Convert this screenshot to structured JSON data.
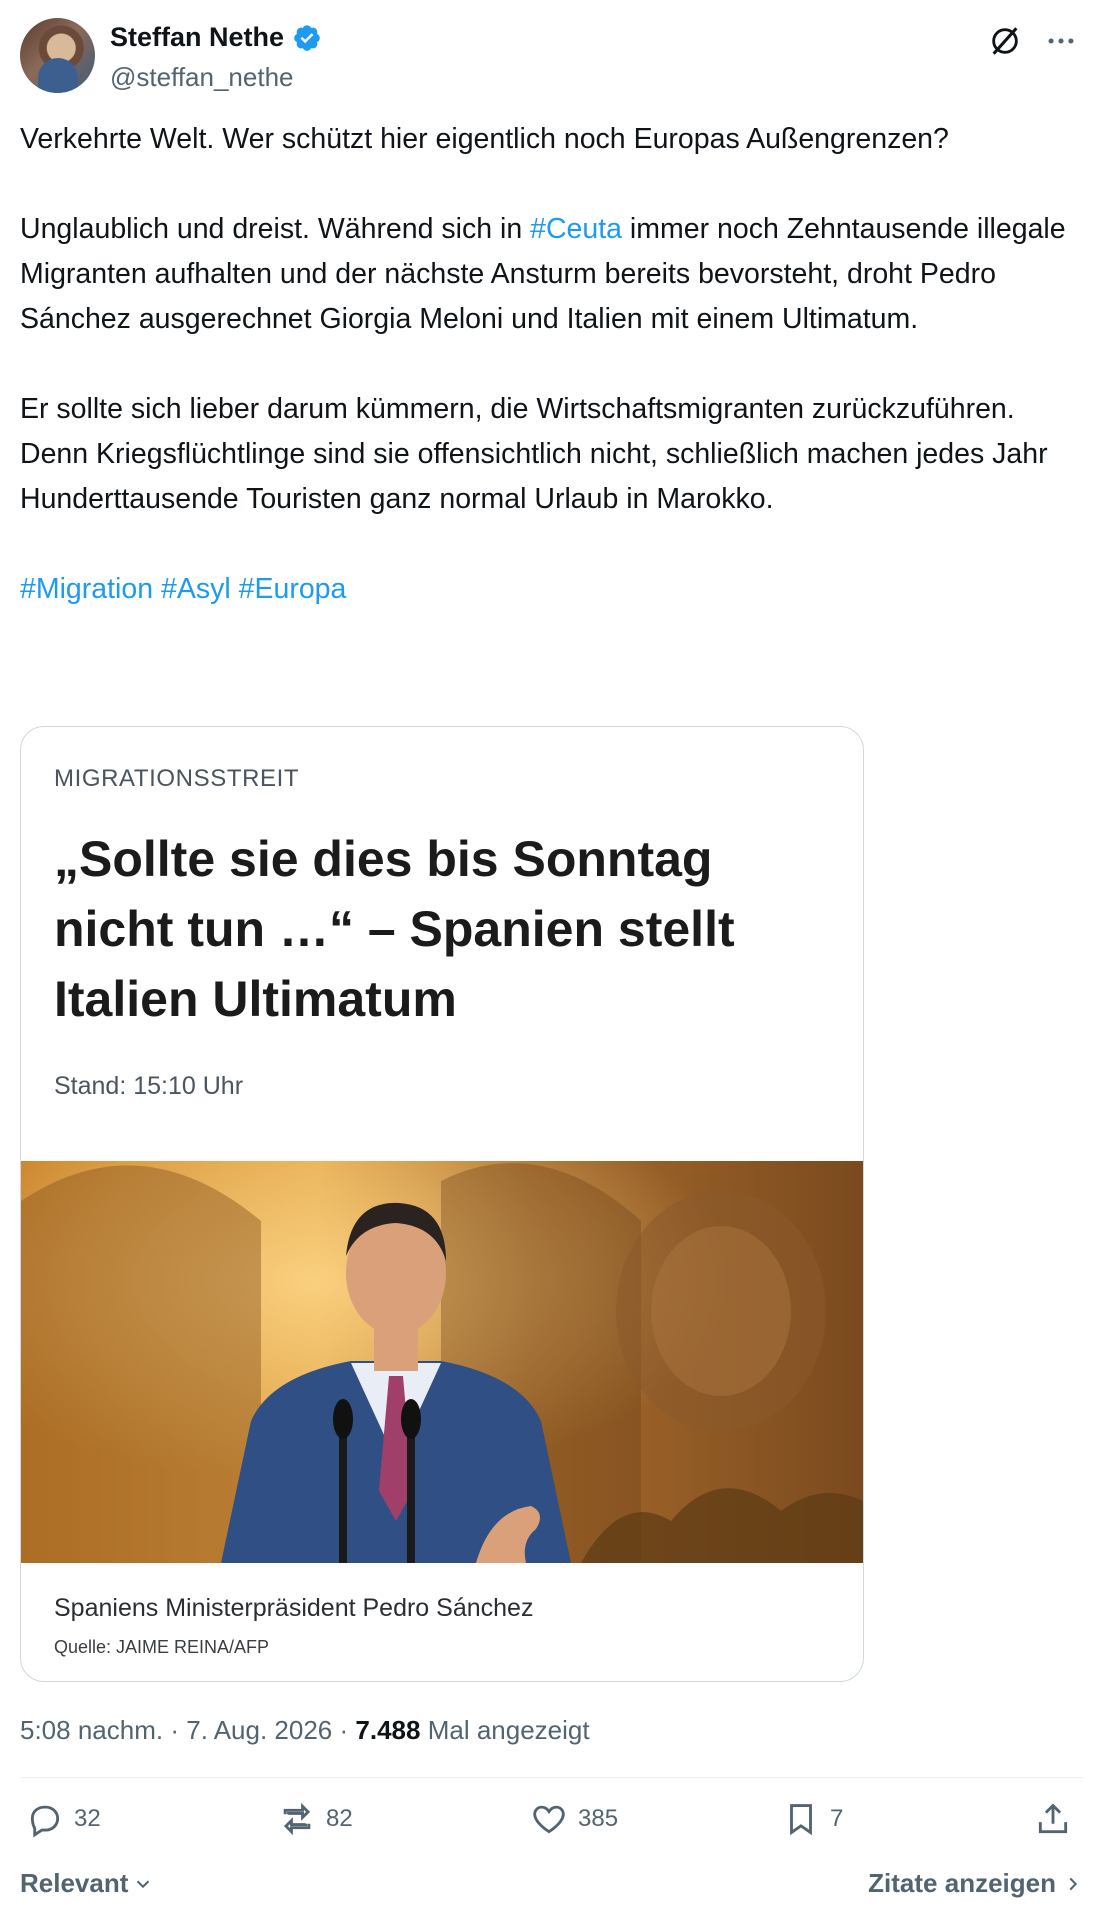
{
  "author": {
    "display_name": "Steffan Nethe",
    "handle": "@steffan_nethe",
    "verified": true
  },
  "tweet": {
    "paragraphs": [
      [
        {
          "t": "Verkehrte Welt. Wer schützt hier eigentlich noch Europas Außengrenzen?"
        }
      ],
      [
        {
          "t": "Unglaublich und dreist. Während sich in "
        },
        {
          "t": "#Ceuta",
          "tag": true
        },
        {
          "t": " immer noch Zehntausende illegale Migranten aufhalten und der nächste Ansturm bereits bevorsteht, droht Pedro Sánchez ausgerechnet Giorgia Meloni und Italien mit einem Ultimatum."
        }
      ],
      [
        {
          "t": "Er sollte sich lieber darum kümmern, die Wirtschaftsmigranten zurückzuführen. Denn Kriegsflüchtlinge sind sie offensichtlich nicht, schließlich machen jedes Jahr Hunderttausende Touristen ganz normal Urlaub in Marokko."
        }
      ],
      [
        {
          "t": "#Migration",
          "tag": true
        },
        {
          "t": " "
        },
        {
          "t": "#Asyl",
          "tag": true
        },
        {
          "t": " "
        },
        {
          "t": "#Europa",
          "tag": true
        }
      ]
    ]
  },
  "card": {
    "kicker": "MIGRATIONSSTREIT",
    "headline": "„Sollte sie dies bis Sonntag nicht tun …“ – Spanien stellt Italien Ultimatum",
    "stand": "Stand: 15:10 Uhr",
    "caption": "Spaniens Ministerpräsident Pedro Sánchez",
    "credit": "Quelle: JAIME REINA/AFP"
  },
  "meta": {
    "time": "5:08 nachm.",
    "date": "7. Aug. 2026",
    "sep": "·",
    "views_count": "7.488",
    "views_label": "Mal angezeigt"
  },
  "actions": {
    "replies": "32",
    "reposts": "82",
    "likes": "385",
    "bookmarks": "7"
  },
  "footer": {
    "sort_label": "Relevant",
    "quotes_label": "Zitate anzeigen"
  },
  "colors": {
    "accent": "#1d9bf0",
    "muted": "#536471",
    "text": "#0f1419"
  }
}
